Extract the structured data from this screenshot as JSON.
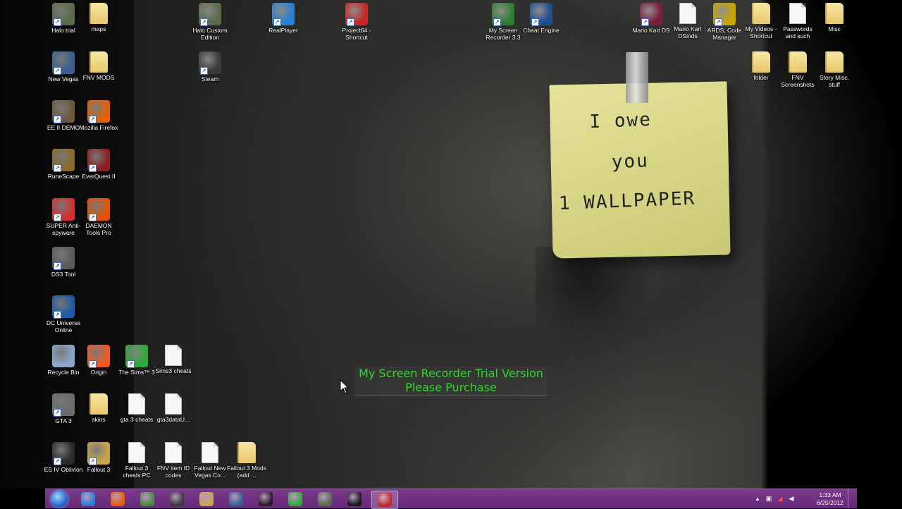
{
  "desktop": {
    "icons": [
      {
        "label": "Halo trial",
        "icon": "halo-icon",
        "type": "app",
        "color": "#5b6b4a"
      },
      {
        "label": "maps",
        "icon": "folder-icon",
        "type": "folder"
      },
      {
        "label": "Halo Custom Edition",
        "icon": "halo-icon",
        "type": "app",
        "color": "#5b6b4a"
      },
      {
        "label": "RealPlayer",
        "icon": "realplayer-icon",
        "type": "app",
        "color": "#2a7fd4"
      },
      {
        "label": "Project64 - Shortcut",
        "icon": "project64-icon",
        "type": "app",
        "color": "#c62828"
      },
      {
        "label": "My Screen Recorder 3.3",
        "icon": "screen-recorder-icon",
        "type": "app",
        "color": "#2e7d32"
      },
      {
        "label": "Cheat Engine",
        "icon": "cheat-engine-icon",
        "type": "app",
        "color": "#1e4f8f"
      },
      {
        "label": "Mario Kart DS",
        "icon": "winrar-icon",
        "type": "app",
        "color": "#7a1f3a"
      },
      {
        "label": "Mario Kart DSinds",
        "icon": "document-icon",
        "type": "doc"
      },
      {
        "label": "ARDS, Code Manager",
        "icon": "ards-icon",
        "type": "app",
        "color": "#c8a400"
      },
      {
        "label": "My Videos - Shortcut",
        "icon": "folder-icon",
        "type": "folder"
      },
      {
        "label": "Passwords and such",
        "icon": "document-icon",
        "type": "doc"
      },
      {
        "label": "Misc",
        "icon": "folder-icon",
        "type": "folder"
      },
      {
        "label": "New Vegas",
        "icon": "vault-boy-icon",
        "type": "app",
        "color": "#3a5f8f"
      },
      {
        "label": "FNV MODS",
        "icon": "folder-icon",
        "type": "folder"
      },
      {
        "label": "Steam",
        "icon": "steam-icon",
        "type": "app",
        "color": "#3a3a3a"
      },
      {
        "label": "folder",
        "icon": "folder-icon",
        "type": "folder"
      },
      {
        "label": "FNV Screenshots",
        "icon": "folder-icon",
        "type": "folder"
      },
      {
        "label": "Story Misc. stuff",
        "icon": "folder-icon",
        "type": "folder"
      },
      {
        "label": "EE II DEMO",
        "icon": "empire-earth-icon",
        "type": "app",
        "color": "#6b5a3a"
      },
      {
        "label": "Mozilla Firefox",
        "icon": "firefox-icon",
        "type": "app",
        "color": "#e66000"
      },
      {
        "label": "RuneScape",
        "icon": "runescape-icon",
        "type": "app",
        "color": "#8a6a2a"
      },
      {
        "label": "EverQuest II",
        "icon": "everquest-icon",
        "type": "app",
        "color": "#8a1f1f"
      },
      {
        "label": "SUPER Anti-spyware",
        "icon": "antispyware-icon",
        "type": "app",
        "color": "#d32f2f"
      },
      {
        "label": "DAEMON Tools Pro",
        "icon": "daemon-tools-icon",
        "type": "app",
        "color": "#e65100"
      },
      {
        "label": "DS3 Tool",
        "icon": "gamepad-icon",
        "type": "app",
        "color": "#5a5a5a"
      },
      {
        "label": "DC Universe Online",
        "icon": "dc-universe-icon",
        "type": "app",
        "color": "#1e5aa8"
      },
      {
        "label": "Recycle Bin",
        "icon": "recycle-bin-icon",
        "type": "app",
        "color": "#8aa6c8"
      },
      {
        "label": "Origin",
        "icon": "origin-icon",
        "type": "app",
        "color": "#f05a22"
      },
      {
        "label": "The Sims™ 3",
        "icon": "sims-icon",
        "type": "app",
        "color": "#2eaa3a"
      },
      {
        "label": "Sims3 cheats",
        "icon": "document-icon",
        "type": "doc"
      },
      {
        "label": "GTA 3",
        "icon": "gta-icon",
        "type": "app",
        "color": "#6b6b6b"
      },
      {
        "label": "skins",
        "icon": "folder-icon",
        "type": "folder"
      },
      {
        "label": "gta 3 cheats",
        "icon": "document-icon",
        "type": "doc"
      },
      {
        "label": "gta3dataU...",
        "icon": "document-icon",
        "type": "doc"
      },
      {
        "label": "ES IV Oblivion",
        "icon": "oblivion-icon",
        "type": "app",
        "color": "#2b2b2b"
      },
      {
        "label": "Fallout 3",
        "icon": "vault-boy-icon",
        "type": "app",
        "color": "#c9a548"
      },
      {
        "label": "Fallout 3 cheats PC",
        "icon": "document-icon",
        "type": "doc"
      },
      {
        "label": "FNV item ID codes",
        "icon": "document-icon",
        "type": "doc"
      },
      {
        "label": "Fallout New Vegas Co...",
        "icon": "document-icon",
        "type": "doc"
      },
      {
        "label": "Fallout 3 Mods (add ...",
        "icon": "folder-icon",
        "type": "folder"
      }
    ]
  },
  "sticky_note": {
    "line1": "I owe",
    "line2": "you",
    "line3": "1 WALLPAPER"
  },
  "watermark": {
    "line1": "My Screen Recorder Trial Version",
    "line2": "Please Purchase"
  },
  "taskbar": {
    "pinned": [
      {
        "name": "internet-explorer-icon",
        "color": "#2a7fd4"
      },
      {
        "name": "firefox-icon",
        "color": "#e66000"
      },
      {
        "name": "minecraft-icon",
        "color": "#4a8a3a"
      },
      {
        "name": "steam-icon",
        "color": "#3a3a3a"
      },
      {
        "name": "vault-boy-icon",
        "color": "#c9a548"
      },
      {
        "name": "new-vegas-icon",
        "color": "#3a5f8f"
      },
      {
        "name": "dark-game-icon",
        "color": "#2a1a2a"
      },
      {
        "name": "sims-icon",
        "color": "#2eaa3a"
      },
      {
        "name": "halo-icon",
        "color": "#5b6b4a"
      },
      {
        "name": "s-app-icon",
        "color": "#1a1a1a"
      },
      {
        "name": "screen-recorder-icon",
        "color": "#c62828"
      }
    ],
    "active_index": 10,
    "clock_time": "1:33 AM",
    "clock_date": "6/25/2012"
  }
}
